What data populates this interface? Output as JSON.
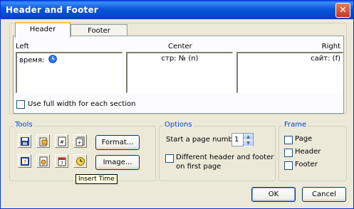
{
  "window": {
    "title": "Header and Footer",
    "close_glyph": "✕"
  },
  "tabs": [
    {
      "label": "Header",
      "active": true
    },
    {
      "label": "Footer",
      "active": false
    }
  ],
  "sections": {
    "left": {
      "label": "Left",
      "value": "время:",
      "icon": "time-field-icon"
    },
    "center": {
      "label": "Center",
      "value": "стр: № (n)"
    },
    "right": {
      "label": "Right",
      "value": "сайт: (f)"
    }
  },
  "use_full_width": {
    "label": "Use full width for each section",
    "checked": false
  },
  "tools": {
    "label": "Tools",
    "format_button": "Format...",
    "image_button": "Image...",
    "tooltip": "Insert Time",
    "icons": [
      "save-icon",
      "open-icon",
      "page-number-icon",
      "total-pages-icon",
      "insert-field-icon",
      "file-name-icon",
      "insert-date-icon",
      "insert-time-icon"
    ]
  },
  "options": {
    "label": "Options",
    "start_page_label": "Start a page number",
    "start_page_value": "1",
    "different_header_label_line1": "Different header and footer",
    "different_header_label_line2": "on first page",
    "different_checked": false
  },
  "frame": {
    "label": "Frame",
    "items": [
      {
        "label": "Page",
        "checked": false
      },
      {
        "label": "Header",
        "checked": false
      },
      {
        "label": "Footer",
        "checked": false
      }
    ]
  },
  "buttons": {
    "ok": "OK",
    "cancel": "Cancel"
  },
  "colors": {
    "accent": "#0046d5",
    "titlebar": "#0b56d9",
    "tab_highlight": "#ffc83c"
  }
}
